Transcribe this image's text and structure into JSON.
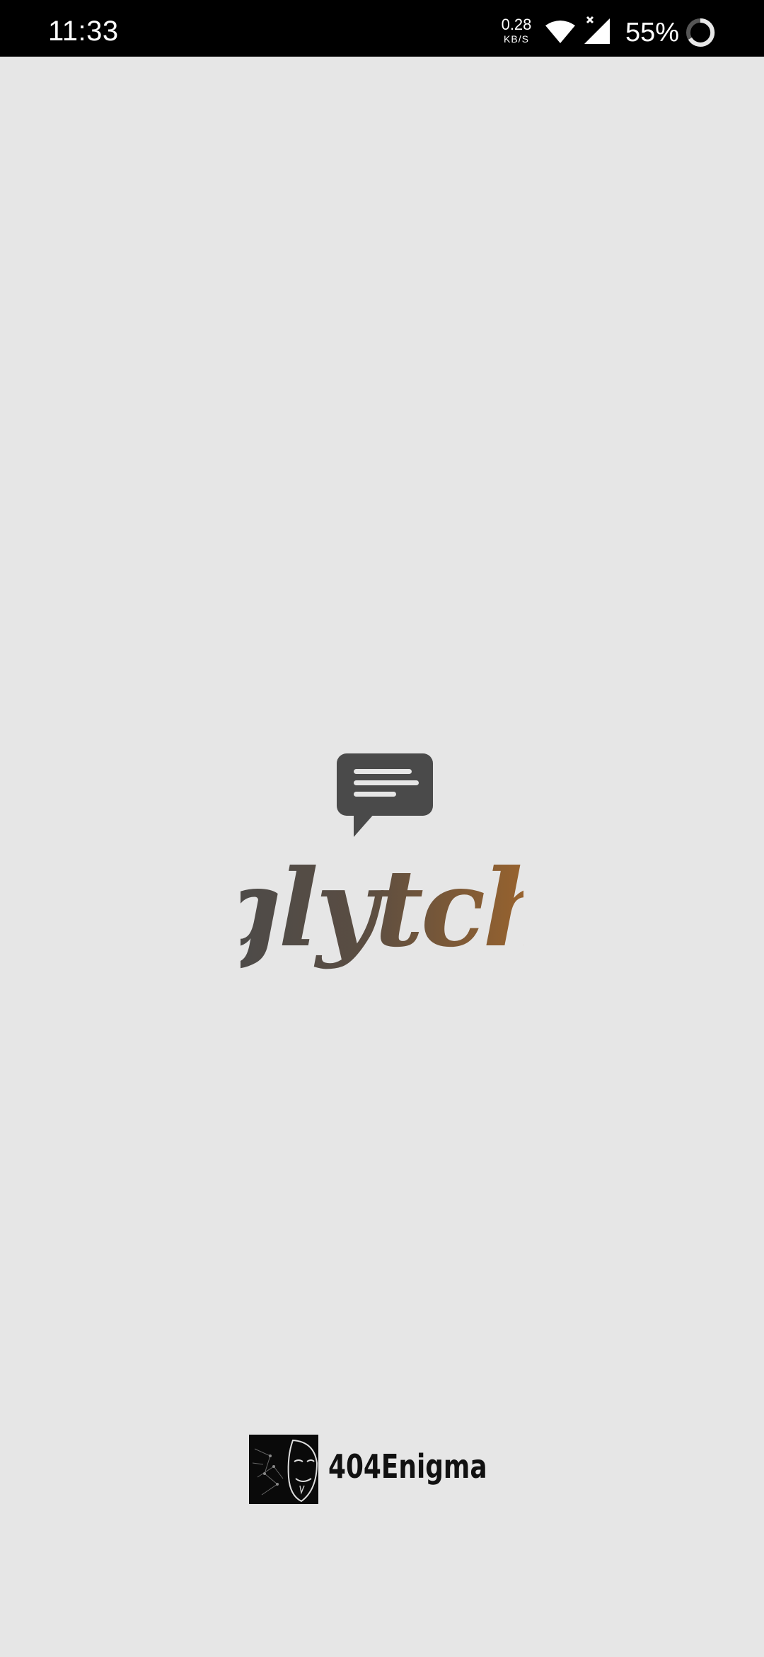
{
  "status_bar": {
    "time": "11:33",
    "net_speed_value": "0.28",
    "net_speed_unit": "KB/S",
    "battery_percent": "55%",
    "icons": [
      "wifi-icon",
      "signal-icon",
      "battery-ring-icon"
    ]
  },
  "splash": {
    "app_name": "glytch",
    "logo_icon": "chat-bubble-icon",
    "colors": {
      "background": "#e6e6e6",
      "icon": "#4a4a4a",
      "wordmark_start": "#4a4a4a",
      "wordmark_end": "#a0652a"
    }
  },
  "credit": {
    "name": "404Enigma",
    "avatar_icon": "anonymous-mask-icon"
  }
}
